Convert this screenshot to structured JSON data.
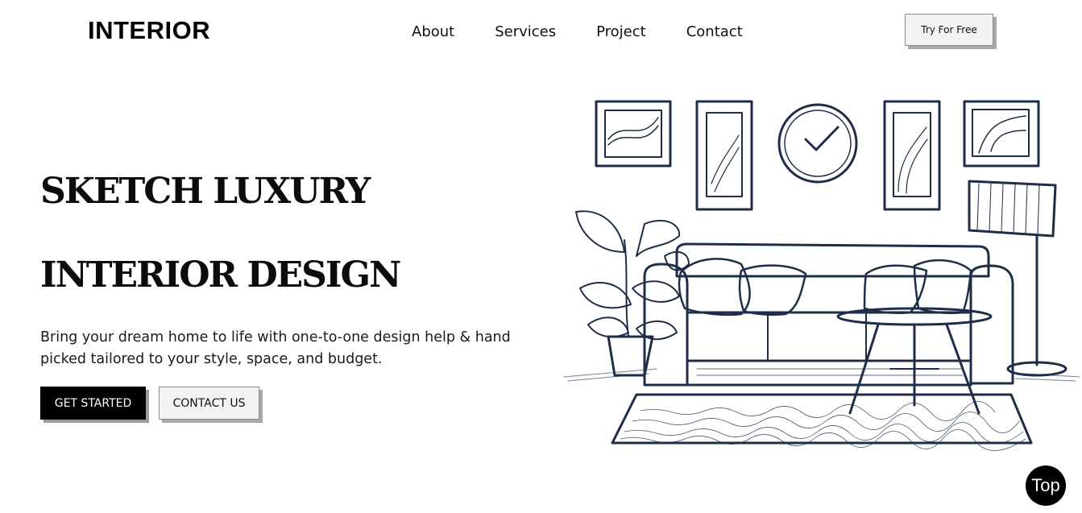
{
  "header": {
    "logo": "INTERIOR",
    "nav": [
      "About",
      "Services",
      "Project",
      "Contact"
    ],
    "cta_label": "Try For Free"
  },
  "hero": {
    "headline_line1": "SKETCH LUXURY",
    "headline_line2": "INTERIOR DESIGN",
    "lead": "Bring your dream home to life with one-to-one design help & hand picked tailored to your style, space, and budget.",
    "primary_button": "GET STARTED",
    "secondary_button": "CONTACT US",
    "illustration_icon": "living-room-sketch"
  },
  "scroll_top_label": "Top",
  "colors": {
    "sketch_ink": "#1f2e48",
    "primary_button_bg": "#000000",
    "secondary_button_bg": "#f2f2f2"
  }
}
